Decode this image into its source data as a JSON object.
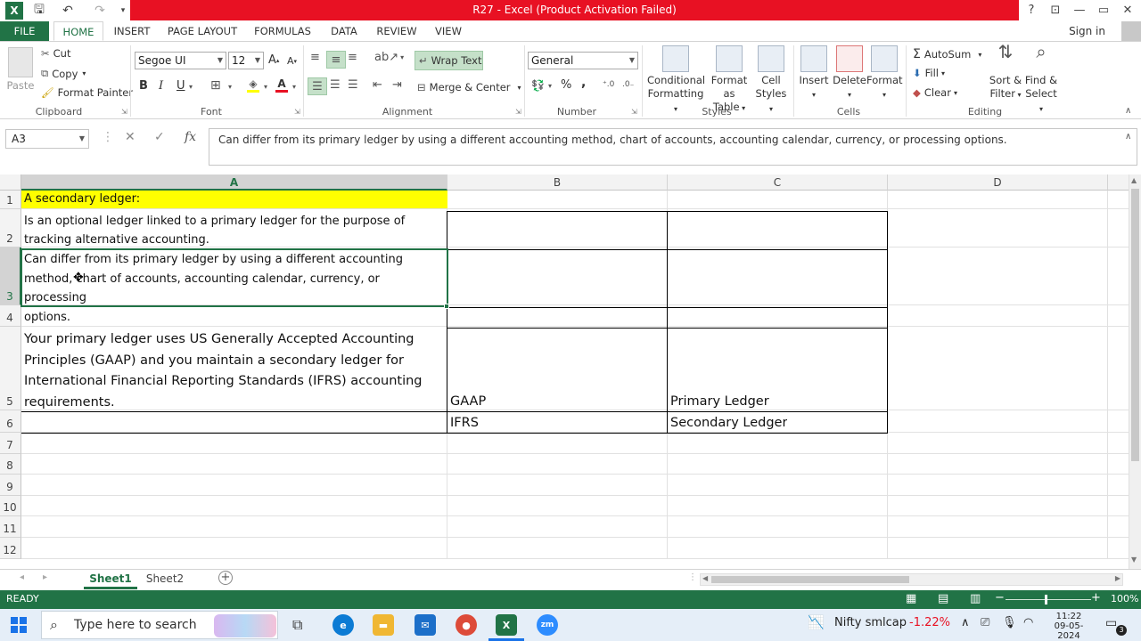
{
  "window": {
    "title": "R27 -  Excel (Product Activation Failed)",
    "help": "?",
    "minimize": "—",
    "restore": "▭",
    "close": "✕"
  },
  "qat": {
    "excel": "X",
    "save": "🖫",
    "undo": "↶",
    "redo": "↷"
  },
  "tabs": [
    "FILE",
    "HOME",
    "INSERT",
    "PAGE LAYOUT",
    "FORMULAS",
    "DATA",
    "REVIEW",
    "VIEW"
  ],
  "active_tab": "HOME",
  "signin": "Sign in",
  "ribbon": {
    "clipboard": {
      "paste": "Paste",
      "cut": "Cut",
      "copy": "Copy",
      "format_painter": "Format Painter",
      "label": "Clipboard"
    },
    "font": {
      "name": "Segoe UI",
      "size": "12",
      "bold": "B",
      "italic": "I",
      "underline": "U",
      "label": "Font"
    },
    "alignment": {
      "wrap_text": "Wrap Text",
      "merge_center": "Merge & Center",
      "label": "Alignment"
    },
    "number": {
      "format": "General",
      "percent": "%",
      "comma": ",",
      "label": "Number"
    },
    "styles": {
      "conditional": "Conditional",
      "conditional2": "Formatting",
      "format_as": "Format as",
      "format_as2": "Table",
      "cell": "Cell",
      "cell2": "Styles",
      "label": "Styles"
    },
    "cells": {
      "insert": "Insert",
      "delete": "Delete",
      "format": "Format",
      "label": "Cells"
    },
    "editing": {
      "autosum": "AutoSum",
      "fill": "Fill",
      "clear": "Clear",
      "sort": "Sort &",
      "sort2": "Filter",
      "find": "Find &",
      "find2": "Select",
      "label": "Editing"
    }
  },
  "formula_bar": {
    "name_box": "A3",
    "cancel": "✕",
    "enter": "✓",
    "fx": "fx",
    "content": "Can differ from its primary ledger by using a different accounting method, chart of accounts, accounting calendar, currency, or processing options."
  },
  "columns": [
    "A",
    "B",
    "C",
    "D"
  ],
  "rows": [
    "1",
    "2",
    "3",
    "4",
    "5",
    "6",
    "7",
    "8",
    "9",
    "10",
    "11",
    "12"
  ],
  "cells": {
    "a1": "A secondary ledger:",
    "a2_l1": "Is an optional ledger linked to a primary ledger for the purpose of",
    "a2_l2": "tracking alternative accounting.",
    "a3_l1": "Can differ from its primary ledger by using a different accounting",
    "a3_l2": "method, chart of accounts, accounting calendar, currency, or processing",
    "a3_l3": "options.",
    "a5_l1": "Your primary ledger uses US Generally Accepted Accounting",
    "a5_l2": "Principles (GAAP) and you maintain a secondary ledger for",
    "a5_l3": "International Financial Reporting Standards (IFRS) accounting",
    "a5_l4": "requirements.",
    "b5": "GAAP",
    "c5": "Primary Ledger",
    "b6": "IFRS",
    "c6": "Secondary Ledger"
  },
  "sheets": [
    "Sheet1",
    "Sheet2"
  ],
  "active_sheet": "Sheet1",
  "status": {
    "ready": "READY",
    "zoom": "100%"
  },
  "taskbar": {
    "search_placeholder": "Type here to search",
    "stock_name": "Nifty smlcap",
    "stock_change": "-1.22%",
    "time": "11:22",
    "date": "09-05-2024",
    "notifications": "3"
  },
  "colors": {
    "excel_green": "#217346",
    "title_red": "#e81123",
    "highlight_yellow": "#ffff00",
    "stock_red": "#e81123"
  }
}
